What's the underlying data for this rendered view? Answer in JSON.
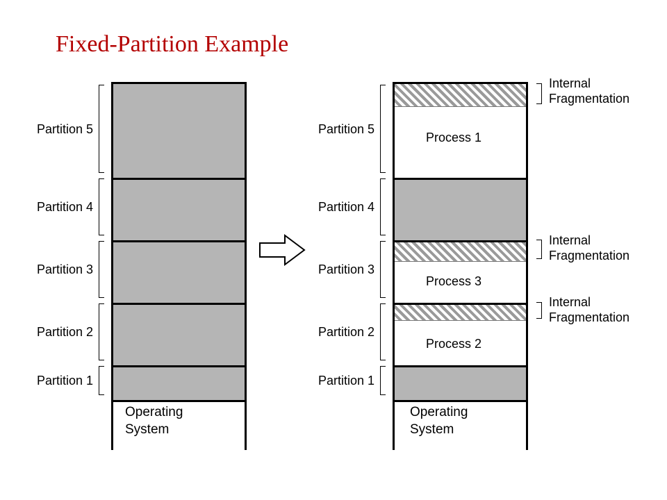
{
  "title": "Fixed-Partition Example",
  "left": {
    "labels": {
      "p1": "Partition 1",
      "p2": "Partition 2",
      "p3": "Partition 3",
      "p4": "Partition 4",
      "p5": "Partition 5"
    },
    "os": "Operating\nSystem"
  },
  "right": {
    "labels": {
      "p1": "Partition 1",
      "p2": "Partition 2",
      "p3": "Partition 3",
      "p4": "Partition 4",
      "p5": "Partition 5"
    },
    "processes": {
      "proc1": "Process 1",
      "proc2": "Process 2",
      "proc3": "Process 3"
    },
    "frag": {
      "f5": "Internal\nFragmentation",
      "f3": "Internal\nFragmentation",
      "f2": "Internal\nFragmentation"
    },
    "os": "Operating\nSystem"
  }
}
